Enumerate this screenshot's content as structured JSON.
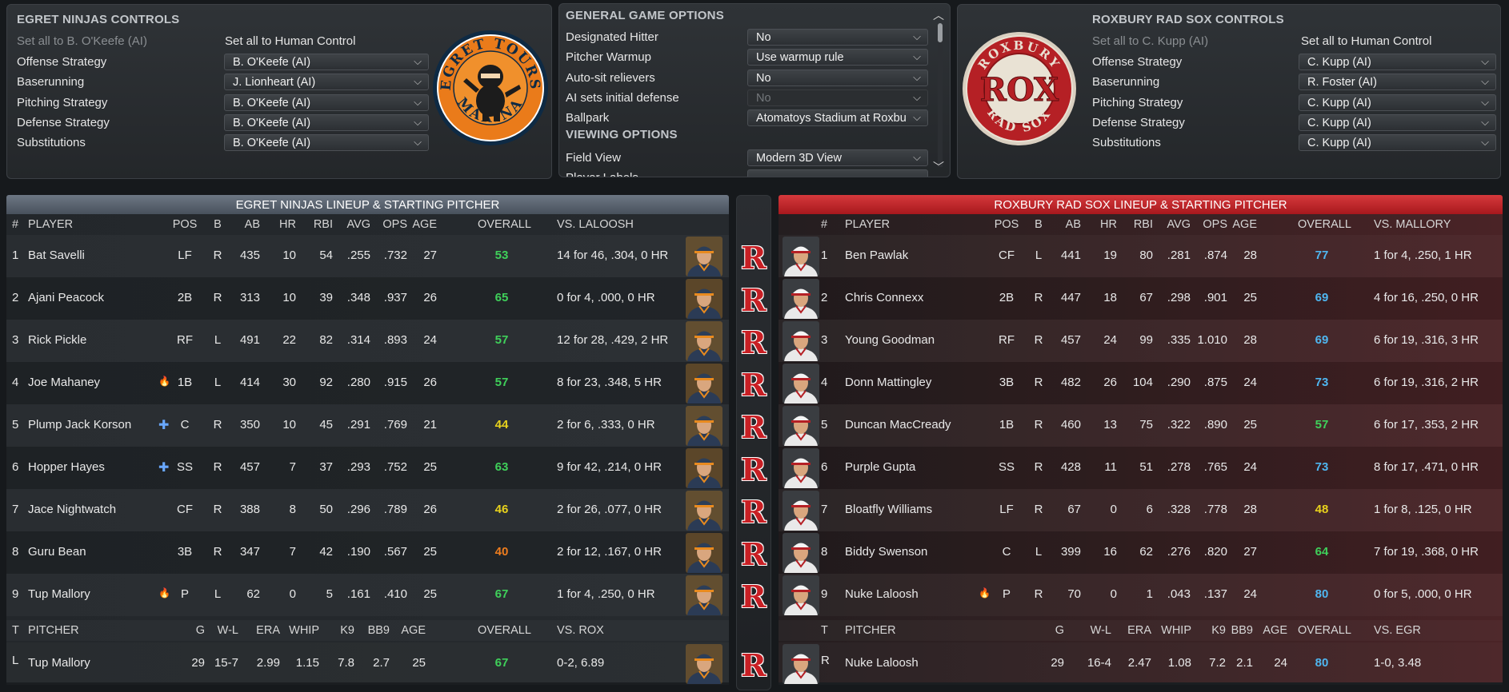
{
  "home_controls": {
    "title": "EGRET NINJAS CONTROLS",
    "set_all_ai": "Set all to B. O'Keefe (AI)",
    "set_all_human": "Set all to Human Control",
    "rows": [
      {
        "label": "Offense Strategy",
        "value": "B. O'Keefe (AI)"
      },
      {
        "label": "Baserunning",
        "value": "J. Lionheart (AI)"
      },
      {
        "label": "Pitching Strategy",
        "value": "B. O'Keefe (AI)"
      },
      {
        "label": "Defense Strategy",
        "value": "B. O'Keefe (AI)"
      },
      {
        "label": "Substitutions",
        "value": "B. O'Keefe (AI)"
      }
    ],
    "logo_text_top": "EGRET TOURS",
    "logo_text_bottom": "MARINA"
  },
  "general_options": {
    "title": "GENERAL GAME OPTIONS",
    "rows": [
      {
        "label": "Designated Hitter",
        "value": "No"
      },
      {
        "label": "Pitcher Warmup",
        "value": "Use warmup rule"
      },
      {
        "label": "Auto-sit relievers",
        "value": "No"
      },
      {
        "label": "AI sets initial defense",
        "value": "No"
      },
      {
        "label": "Ballpark",
        "value": "Atomatoys Stadium at Roxbu"
      }
    ],
    "viewing_title": "VIEWING OPTIONS",
    "viewing_rows": [
      {
        "label": "Field View",
        "value": "Modern 3D View"
      },
      {
        "label": "Player Labels",
        "value": ""
      }
    ]
  },
  "away_controls": {
    "title": "ROXBURY RAD SOX CONTROLS",
    "set_all_ai": "Set all to C. Kupp (AI)",
    "set_all_human": "Set all to Human Control",
    "rows": [
      {
        "label": "Offense Strategy",
        "value": "C. Kupp (AI)"
      },
      {
        "label": "Baserunning",
        "value": "R. Foster (AI)"
      },
      {
        "label": "Pitching Strategy",
        "value": "C. Kupp (AI)"
      },
      {
        "label": "Defense Strategy",
        "value": "C. Kupp (AI)"
      },
      {
        "label": "Substitutions",
        "value": "C. Kupp (AI)"
      }
    ],
    "logo_text": "ROX",
    "logo_text_top": "ROXBURY",
    "logo_text_bottom": "RAD SOX"
  },
  "home_lineup": {
    "title": "EGRET NINJAS LINEUP & STARTING PITCHER",
    "headers": [
      "#",
      "PLAYER",
      "POS",
      "B",
      "AB",
      "HR",
      "RBI",
      "AVG",
      "OPS",
      "AGE",
      "OVERALL",
      "VS. LALOOSH"
    ],
    "rows": [
      {
        "num": "1",
        "player": "Bat Savelli",
        "icon": "",
        "pos": "LF",
        "b": "R",
        "ab": "435",
        "hr": "10",
        "rbi": "54",
        "avg": ".255",
        "ops": ".732",
        "age": "27",
        "overall": "53",
        "ovr_color": "#3fd05a",
        "vs": "14 for 46, .304, 0 HR"
      },
      {
        "num": "2",
        "player": "Ajani Peacock",
        "icon": "",
        "pos": "2B",
        "b": "R",
        "ab": "313",
        "hr": "10",
        "rbi": "39",
        "avg": ".348",
        "ops": ".937",
        "age": "26",
        "overall": "65",
        "ovr_color": "#3fd05a",
        "vs": "0 for 4, .000, 0 HR"
      },
      {
        "num": "3",
        "player": "Rick Pickle",
        "icon": "",
        "pos": "RF",
        "b": "L",
        "ab": "491",
        "hr": "22",
        "rbi": "82",
        "avg": ".314",
        "ops": ".893",
        "age": "24",
        "overall": "57",
        "ovr_color": "#3fd05a",
        "vs": "12 for 28, .429, 2 HR"
      },
      {
        "num": "4",
        "player": "Joe Mahaney",
        "icon": "fire-icon",
        "pos": "1B",
        "b": "L",
        "ab": "414",
        "hr": "30",
        "rbi": "92",
        "avg": ".280",
        "ops": ".915",
        "age": "26",
        "overall": "57",
        "ovr_color": "#3fd05a",
        "vs": "8 for 23, .348, 5 HR"
      },
      {
        "num": "5",
        "player": "Plump Jack Korson",
        "icon": "medical-icon",
        "pos": "C",
        "b": "R",
        "ab": "350",
        "hr": "10",
        "rbi": "45",
        "avg": ".291",
        "ops": ".769",
        "age": "21",
        "overall": "44",
        "ovr_color": "#e8d21c",
        "vs": "2 for 6, .333, 0 HR"
      },
      {
        "num": "6",
        "player": "Hopper Hayes",
        "icon": "medical-icon",
        "pos": "SS",
        "b": "R",
        "ab": "457",
        "hr": "7",
        "rbi": "37",
        "avg": ".293",
        "ops": ".752",
        "age": "25",
        "overall": "63",
        "ovr_color": "#3fd05a",
        "vs": "9 for 42, .214, 0 HR"
      },
      {
        "num": "7",
        "player": "Jace Nightwatch",
        "icon": "",
        "pos": "CF",
        "b": "R",
        "ab": "388",
        "hr": "8",
        "rbi": "50",
        "avg": ".296",
        "ops": ".789",
        "age": "26",
        "overall": "46",
        "ovr_color": "#e8d21c",
        "vs": "2 for 26, .077, 0 HR"
      },
      {
        "num": "8",
        "player": "Guru Bean",
        "icon": "",
        "pos": "3B",
        "b": "R",
        "ab": "347",
        "hr": "7",
        "rbi": "42",
        "avg": ".190",
        "ops": ".567",
        "age": "25",
        "overall": "40",
        "ovr_color": "#ef7d1e",
        "vs": "2 for 12, .167, 0 HR"
      },
      {
        "num": "9",
        "player": "Tup Mallory",
        "icon": "fire-icon",
        "pos": "P",
        "b": "L",
        "ab": "62",
        "hr": "0",
        "rbi": "5",
        "avg": ".161",
        "ops": ".410",
        "age": "25",
        "overall": "67",
        "ovr_color": "#3fd05a",
        "vs": "1 for 4, .250, 0 HR"
      }
    ],
    "pitcher_headers": [
      "T",
      "PITCHER",
      "G",
      "W-L",
      "ERA",
      "WHIP",
      "K9",
      "BB9",
      "AGE",
      "OVERALL",
      "VS. ROX"
    ],
    "pitcher": {
      "t": "L",
      "name": "Tup Mallory",
      "g": "29",
      "wl": "15-7",
      "era": "2.99",
      "whip": "1.15",
      "k9": "7.8",
      "bb9": "2.7",
      "age": "25",
      "overall": "67",
      "ovr_color": "#3fd05a",
      "vs": "0-2, 6.89"
    }
  },
  "away_lineup": {
    "title": "ROXBURY RAD SOX LINEUP & STARTING PITCHER",
    "headers": [
      "#",
      "PLAYER",
      "POS",
      "B",
      "AB",
      "HR",
      "RBI",
      "AVG",
      "OPS",
      "AGE",
      "OVERALL",
      "VS. MALLORY"
    ],
    "rows": [
      {
        "num": "1",
        "player": "Ben Pawlak",
        "icon": "",
        "pos": "CF",
        "b": "L",
        "ab": "441",
        "hr": "19",
        "rbi": "80",
        "avg": ".281",
        "ops": ".874",
        "age": "28",
        "overall": "77",
        "ovr_color": "#4fb6f0",
        "vs": "1 for 4, .250, 1 HR"
      },
      {
        "num": "2",
        "player": "Chris Connexx",
        "icon": "",
        "pos": "2B",
        "b": "R",
        "ab": "447",
        "hr": "18",
        "rbi": "67",
        "avg": ".298",
        "ops": ".901",
        "age": "25",
        "overall": "69",
        "ovr_color": "#4fb6f0",
        "vs": "4 for 16, .250, 0 HR"
      },
      {
        "num": "3",
        "player": "Young Goodman",
        "icon": "",
        "pos": "RF",
        "b": "R",
        "ab": "457",
        "hr": "24",
        "rbi": "99",
        "avg": ".335",
        "ops": "1.010",
        "age": "28",
        "overall": "69",
        "ovr_color": "#4fb6f0",
        "vs": "6 for 19, .316, 3 HR"
      },
      {
        "num": "4",
        "player": "Donn Mattingley",
        "icon": "",
        "pos": "3B",
        "b": "R",
        "ab": "482",
        "hr": "26",
        "rbi": "104",
        "avg": ".290",
        "ops": ".875",
        "age": "24",
        "overall": "73",
        "ovr_color": "#4fb6f0",
        "vs": "6 for 19, .316, 2 HR"
      },
      {
        "num": "5",
        "player": "Duncan MacCready",
        "icon": "",
        "pos": "1B",
        "b": "R",
        "ab": "460",
        "hr": "13",
        "rbi": "75",
        "avg": ".322",
        "ops": ".890",
        "age": "25",
        "overall": "57",
        "ovr_color": "#3fd05a",
        "vs": "6 for 17, .353, 2 HR"
      },
      {
        "num": "6",
        "player": "Purple Gupta",
        "icon": "",
        "pos": "SS",
        "b": "R",
        "ab": "428",
        "hr": "11",
        "rbi": "51",
        "avg": ".278",
        "ops": ".765",
        "age": "24",
        "overall": "73",
        "ovr_color": "#4fb6f0",
        "vs": "8 for 17, .471, 0 HR"
      },
      {
        "num": "7",
        "player": "Bloatfly Williams",
        "icon": "",
        "pos": "LF",
        "b": "R",
        "ab": "67",
        "hr": "0",
        "rbi": "6",
        "avg": ".328",
        "ops": ".778",
        "age": "28",
        "overall": "48",
        "ovr_color": "#e8d21c",
        "vs": "1 for 8, .125, 0 HR"
      },
      {
        "num": "8",
        "player": "Biddy Swenson",
        "icon": "",
        "pos": "C",
        "b": "L",
        "ab": "399",
        "hr": "16",
        "rbi": "62",
        "avg": ".276",
        "ops": ".820",
        "age": "27",
        "overall": "64",
        "ovr_color": "#3fd05a",
        "vs": "7 for 19, .368, 0 HR"
      },
      {
        "num": "9",
        "player": "Nuke Laloosh",
        "icon": "fire-icon",
        "pos": "P",
        "b": "R",
        "ab": "70",
        "hr": "0",
        "rbi": "1",
        "avg": ".043",
        "ops": ".137",
        "age": "24",
        "overall": "80",
        "ovr_color": "#4fb6f0",
        "vs": "0 for 5, .000, 0 HR"
      }
    ],
    "pitcher_headers": [
      "T",
      "PITCHER",
      "G",
      "W-L",
      "ERA",
      "WHIP",
      "K9",
      "BB9",
      "AGE",
      "OVERALL",
      "VS. EGR"
    ],
    "pitcher": {
      "t": "R",
      "name": "Nuke Laloosh",
      "g": "29",
      "wl": "16-4",
      "era": "2.47",
      "whip": "1.08",
      "k9": "7.2",
      "bb9": "2.1",
      "age": "24",
      "overall": "80",
      "ovr_color": "#4fb6f0",
      "vs": "1-0, 3.48"
    }
  },
  "badge_letter": "R",
  "colors": {
    "green": "#3fd05a",
    "blue": "#4fb6f0",
    "yellow": "#e8d21c",
    "orange": "#ef7d1e",
    "home_header": "#5a6470",
    "away_header": "#c0282c"
  }
}
